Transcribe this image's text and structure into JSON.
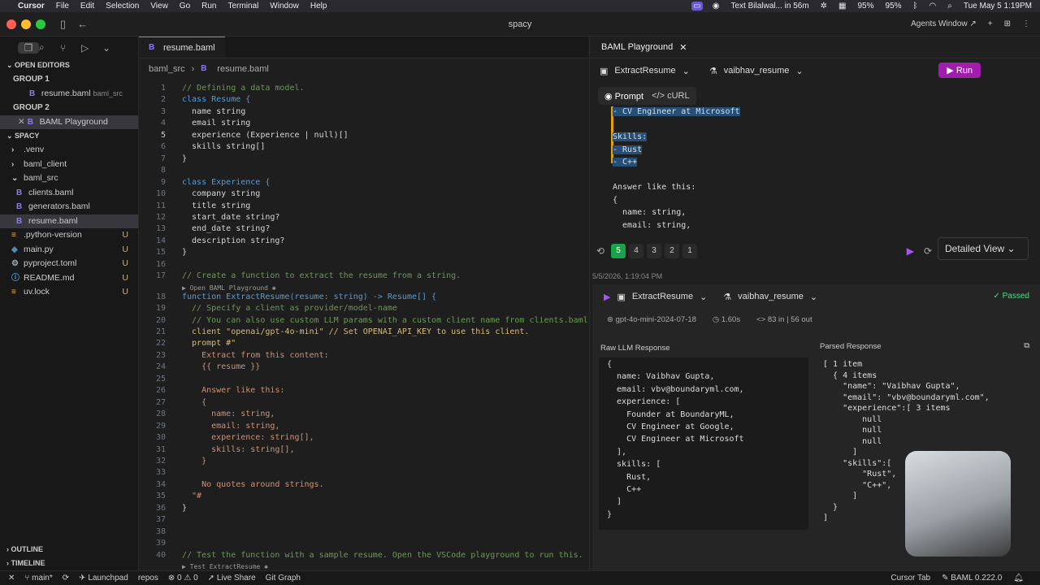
{
  "menubar": {
    "app": "Cursor",
    "items": [
      "File",
      "Edit",
      "Selection",
      "View",
      "Go",
      "Run",
      "Terminal",
      "Window",
      "Help"
    ],
    "tray_notice": "Text Bilalwal... in 56m",
    "battery1": "95%",
    "battery2": "95%",
    "datetime": "Tue May 5  1:19PM"
  },
  "window": {
    "title": "spacy",
    "agents_window": "Agents Window ↗"
  },
  "sidebar": {
    "open_editors": "OPEN EDITORS",
    "group1": "GROUP 1",
    "group1_file": "resume.baml",
    "group1_file_path": "baml_src",
    "group2": "GROUP 2",
    "group2_file": "BAML Playground",
    "project": "SPACY",
    "tree": [
      {
        "label": ".venv",
        "indent": 1,
        "kind": "folder",
        "badge": ""
      },
      {
        "label": "baml_client",
        "indent": 1,
        "kind": "folder",
        "badge": ""
      },
      {
        "label": "baml_src",
        "indent": 1,
        "kind": "folder-open",
        "badge": ""
      },
      {
        "label": "clients.baml",
        "indent": 2,
        "kind": "baml",
        "badge": ""
      },
      {
        "label": "generators.baml",
        "indent": 2,
        "kind": "baml",
        "badge": ""
      },
      {
        "label": "resume.baml",
        "indent": 2,
        "kind": "baml",
        "badge": ""
      },
      {
        "label": ".python-version",
        "indent": 1,
        "kind": "file",
        "badge": "U"
      },
      {
        "label": "main.py",
        "indent": 1,
        "kind": "py",
        "badge": "U"
      },
      {
        "label": "pyproject.toml",
        "indent": 1,
        "kind": "toml",
        "badge": "U"
      },
      {
        "label": "README.md",
        "indent": 1,
        "kind": "md",
        "badge": "U"
      },
      {
        "label": "uv.lock",
        "indent": 1,
        "kind": "lock",
        "badge": "U"
      }
    ],
    "outline": "OUTLINE",
    "timeline": "TIMELINE"
  },
  "editor": {
    "tab": "resume.baml",
    "breadcrumb": [
      "baml_src",
      "resume.baml"
    ],
    "codelens1": "▶ Open BAML Playground ✱",
    "codelens2": "▶ Test ExtractResume ✱",
    "lines": [
      "// Defining a data model.",
      "class Resume {",
      "  name string",
      "  email string",
      "  experience (Experience | null)[]",
      "  skills string[]",
      "}",
      "",
      "class Experience {",
      "  company string",
      "  title string",
      "  start_date string?",
      "  end_date string?",
      "  description string?",
      "}",
      "",
      "// Create a function to extract the resume from a string.",
      "function ExtractResume(resume: string) -> Resume[] {",
      "  // Specify a client as provider/model-name",
      "  // You can also use custom LLM params with a custom client name from clients.baml lik",
      "  client \"openai/gpt-4o-mini\" // Set OPENAI_API_KEY to use this client.",
      "  prompt #\"",
      "    Extract from this content:",
      "    {{ resume }}",
      "",
      "    Answer like this:",
      "    {",
      "      name: string,",
      "      email: string,",
      "      experience: string[],",
      "      skills: string[],",
      "    }",
      "",
      "    No quotes around strings.",
      "  \"#",
      "}",
      "",
      "",
      "",
      "// Test the function with a sample resume. Open the VSCode playground to run this."
    ]
  },
  "playground": {
    "tab": "BAML Playground",
    "function": "ExtractResume",
    "test": "vaibhav_resume",
    "run": "Run",
    "prompt_tab": "Prompt",
    "curl_tab": "cURL",
    "prompt_lines": [
      "- CV Engineer at Microsoft",
      "",
      "Skills:",
      "- Rust",
      "- C++",
      "",
      "Answer like this:",
      "{",
      "  name: string,",
      "  email: string,"
    ],
    "history": [
      "5",
      "4",
      "3",
      "2",
      "1"
    ],
    "view": "Detailed View",
    "timestamp": "5/5/2026, 1:19:04 PM",
    "result": {
      "function": "ExtractResume",
      "test": "vaibhav_resume",
      "status": "Passed",
      "model": "gpt-4o-mini-2024-07-18",
      "latency": "1.60s",
      "tokens": "83 in | 56 out",
      "raw_label": "Raw LLM Response",
      "parsed_label": "Parsed Response",
      "raw_lines": [
        "{",
        "  name: Vaibhav Gupta,",
        "  email: vbv@boundaryml.com,",
        "  experience: [",
        "    Founder at BoundaryML,",
        "    CV Engineer at Google,",
        "    CV Engineer at Microsoft",
        "  ],",
        "  skills: [",
        "    Rust,",
        "    C++",
        "  ]",
        "}"
      ],
      "parsed_lines": [
        "[ 1 item",
        "  { 4 items",
        "    \"name\": \"Vaibhav Gupta\",",
        "    \"email\": \"vbv@boundaryml.com\",",
        "    \"experience\":[ 3 items",
        "        null",
        "        null",
        "        null",
        "      ]",
        "    \"skills\":[",
        "        \"Rust\",",
        "        \"C++\",",
        "      ]",
        "  }",
        "]"
      ]
    }
  },
  "status": {
    "branch": "main*",
    "launchpad": "Launchpad",
    "repos": "repos",
    "errors": "0",
    "warnings": "0",
    "live_share": "Live Share",
    "git_graph": "Git Graph",
    "cursor_tab": "Cursor Tab",
    "baml_version": "BAML 0.222.0"
  }
}
